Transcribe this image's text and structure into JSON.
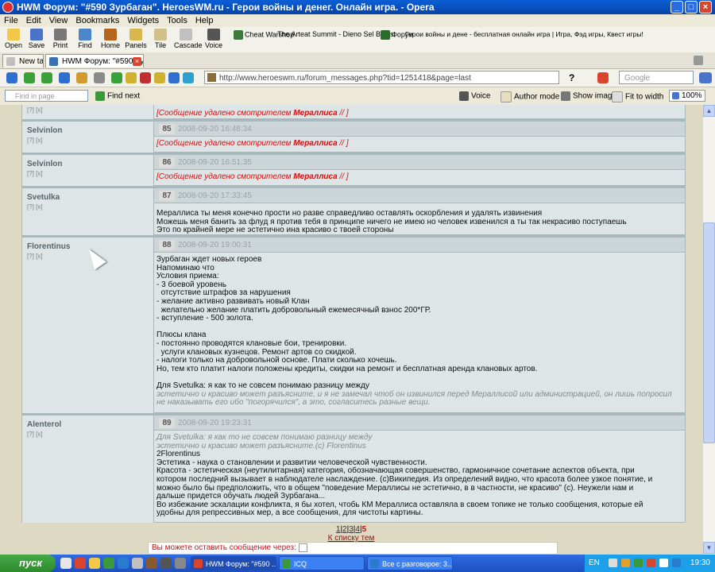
{
  "window": {
    "title": "HWM Форум: \"#590 Зурбаган\". HeroesWM.ru - Герои войны и денег. Онлайн игра. - Opera",
    "min": "_",
    "max": "□",
    "close": "×"
  },
  "menu": [
    "File",
    "Edit",
    "View",
    "Bookmarks",
    "Widgets",
    "Tools",
    "Help"
  ],
  "toolbar": {
    "buttons": [
      {
        "label": "Open",
        "color": "#f2c84b"
      },
      {
        "label": "Save",
        "color": "#4a74c9"
      },
      {
        "label": "Print",
        "color": "#777777"
      },
      {
        "label": "Find",
        "color": "#4b86c8"
      },
      {
        "label": "Home",
        "color": "#b5651d"
      },
      {
        "label": "Panels",
        "color": "#d9b64e"
      },
      {
        "label": "Tile",
        "color": "#d0c08a"
      },
      {
        "label": "Cascade",
        "color": "#c0c0c0"
      },
      {
        "label": "Voice",
        "color": "#555555"
      }
    ],
    "bookmarks": [
      {
        "label": "Cheat Warshop",
        "color": "#3a7a3a"
      },
      {
        "label": "The Arteat Summit - Dieno Sel Benls",
        "color": "#6f6f6f"
      },
      {
        "label": "Форум",
        "color": "#2a6a2a"
      },
      {
        "label": "Герои войны и дене - бесплатная онлайн игра | Игра, Фэд игры, Квест игры!",
        "color": "#333333"
      }
    ]
  },
  "tabs": [
    {
      "label": "New tab",
      "active": false
    },
    {
      "label": "HWM Форум: \"#590 Зур...",
      "active": true
    }
  ],
  "nav": {
    "url": "http://www.heroeswm.ru/forum_messages.php?tid=1251418&page=last",
    "search_placeholder": "Google",
    "help": "?"
  },
  "findbar": {
    "placeholder": "Find in page",
    "find_next": "Find next",
    "voice": "Voice",
    "author_mode": "Author mode",
    "show_images": "Show images",
    "fit_to_width": "Fit to width",
    "zoom": "100%"
  },
  "posts": [
    {
      "author": "",
      "links": "[?] [х]",
      "number": "",
      "date": "",
      "deleted": true,
      "moderator": "Мераллиса",
      "lines": []
    },
    {
      "author": "Selvinlon",
      "links": "[?] [х]",
      "number": "85",
      "date": "2008-09-20 16:48:34",
      "deleted": true,
      "moderator": "Мераллиса",
      "lines": []
    },
    {
      "author": "Selvinlon",
      "links": "[?] [х]",
      "number": "86",
      "date": "2008-09-20 16:51:35",
      "deleted": true,
      "moderator": "Мераллиса",
      "lines": []
    },
    {
      "author": "Svetulka",
      "links": "[?] [х]",
      "number": "87",
      "date": "2008-09-20 17:33:45",
      "deleted": false,
      "lines": [
        "Мераллиса ты меня конечно прости но разве справедливо оставлять оскорбления и удалять извинения",
        "Можешь меня банить за флуд я против тебя в принципе ничего не имею но человек извенился а ты так некрасиво поступаешь",
        "Это по крайней мере не эстетично ина красиво с твоей стороны"
      ]
    },
    {
      "author": "Florentinus",
      "links": "[?] [х]",
      "number": "88",
      "date": "2008-09-20 19:00:31",
      "deleted": false,
      "lines": [
        "Зурбаган ждет новых героев",
        "Напоминаю что",
        "Условия приема:",
        "- 3 боевой уровень",
        "  отсутствие штрафов за нарушения",
        "- желание активно развивать новый Клан",
        "  желательно желание платить добровольный ежемесячный взнос 200*ГР.",
        "- вступление - 500 золота.",
        "",
        "Плюсы клана",
        "- постоянно проводятся клановые бои, тренировки.",
        "  услуги клановых кузнецов. Ремонт артов со скидкой.",
        "- налоги только на добровольной основе. Плати сколько хочешь.",
        "Но, тем кто платит налоги положены кредиты, скидки на ремонт и бесплатная аренда клановых артов.",
        "",
        "Для Svetulka: я как то не совсем понимаю разницу между",
        "эстетично и красиво может разъясните, и я не замечал чтоб он извинился перед Мераллисой или администрацией, он лишь попросил",
        "не наказывать его ибо \"погорячился\", а это, согласитесь разные вещи."
      ]
    },
    {
      "author": "Alenterol",
      "links": "[?] [х]",
      "number": "89",
      "date": "2008-09-20 19:23:31",
      "deleted": false,
      "lines": [
        "Для Svetulka: я как то не совсем понимаю разницу между",
        "эстетично и красиво может разъясните.(с) Florentinus",
        "2Florentinus",
        "Эстетика - наука о становлении и развитии человеческой чувственности.",
        "Красота - эстетическая (неутилитарная) категория, обозначающая совершенство, гармоничное сочетание аспектов объекта, при",
        "котором последний вызывает в наблюдателе наслаждение. (с)Википедия. Из определений видно, что красота более узкое понятие, и",
        "можно было бы предположить, что в общем \"поведение Мераллисы не эстетично, в в частности, не красиво\" (с). Неужели нам и",
        "дальше придется обучать людей Зурбагана...",
        "Во избежание эскалации конфликта, я бы хотел, чтобь КМ Мераллиса оставляла в своем топике не только сообщения, которые ей",
        "удобны для репрессивных мер, а все сообщения, для чистоты картины."
      ]
    }
  ],
  "deleted_text": {
    "prefix": "[Сообщение удалено смотрителем ",
    "suffix": " // ]"
  },
  "pager": {
    "pages": [
      "1",
      "2",
      "3",
      "4"
    ],
    "current": "5",
    "back": "К списку тем"
  },
  "reply_prompt": "Вы можете оставить сообщение через: ",
  "taskbar": {
    "start": "пуск",
    "tasks": [
      {
        "label": "HWM Форум: \"#590 ...",
        "active": true,
        "color": "#d9442f"
      },
      {
        "label": "ICQ",
        "active": false,
        "color": "#3a9a3a"
      },
      {
        "label": "Все с разговорое: 3...",
        "active": false,
        "color": "#2a7ad0"
      }
    ],
    "lang": "EN",
    "clock": "19:30"
  }
}
